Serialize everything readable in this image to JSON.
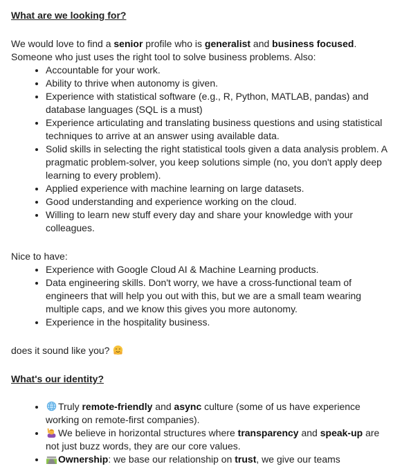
{
  "section1": {
    "heading": "What are we looking for?",
    "intro": [
      "We would love to find a ",
      "senior",
      " profile who is ",
      "generalist",
      " and ",
      "business focused",
      ". Someone who just uses the right tool to solve business problems. Also:"
    ],
    "requirements": [
      "Accountable for your work.",
      "Ability to thrive when autonomy is given.",
      "Experience with statistical software (e.g., R, Python, MATLAB, pandas) and database languages (SQL is a must)",
      "Experience articulating and translating business questions and using statistical techniques to arrive at an answer using available data.",
      "Solid skills in selecting the right statistical tools given a data analysis problem. A pragmatic problem-solver, you keep solutions simple (no, you don't apply deep learning to every problem).",
      "Applied experience with machine learning on large datasets.",
      "Good understanding and experience working on the cloud.",
      "Willing to learn new stuff every day and share your knowledge with your colleagues."
    ],
    "nice_label": "Nice to have:",
    "nice_to_have": [
      "Experience with Google Cloud AI & Machine Learning products.",
      "Data engineering skills. Don't worry, we have a cross-functional team of engineers that will help you out with this, but we are a small team wearing multiple caps, and we know this gives you more autonomy.",
      "Experience in the hospitality business."
    ],
    "closing": "does it sound like you?",
    "closing_icon": "hugging-face-emoji"
  },
  "section2": {
    "heading": "What's our identity?",
    "items": [
      {
        "icon": "globe-emoji",
        "parts": [
          "Truly ",
          "remote-friendly",
          " and ",
          "async",
          " culture (some of us have experience working on remote-first companies)."
        ]
      },
      {
        "icon": "person-raising-hand-emoji",
        "parts": [
          "We believe in horizontal structures where ",
          "transparency",
          " and ",
          "speak-up",
          " are not just buzz words, they are our core values."
        ]
      },
      {
        "icon": "motorway-emoji",
        "parts": [
          "Ownership",
          ": we base our relationship on ",
          "trust",
          ", we give our teams"
        ]
      }
    ]
  }
}
